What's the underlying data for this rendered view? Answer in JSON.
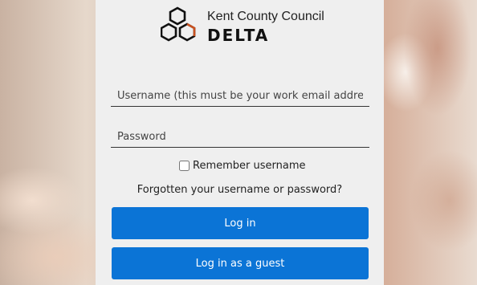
{
  "logo": {
    "organisation": "Kent County Council",
    "brand": "DELTA",
    "accent_color": "#c9511f"
  },
  "form": {
    "username_placeholder": "Username (this must be your work email address)",
    "password_placeholder": "Password",
    "remember_label": "Remember username",
    "forgot_link": "Forgotten your username or password?",
    "login_button": "Log in",
    "guest_button": "Log in as a guest"
  },
  "colors": {
    "primary_button": "#0b74d6",
    "card_background": "#efefef"
  }
}
